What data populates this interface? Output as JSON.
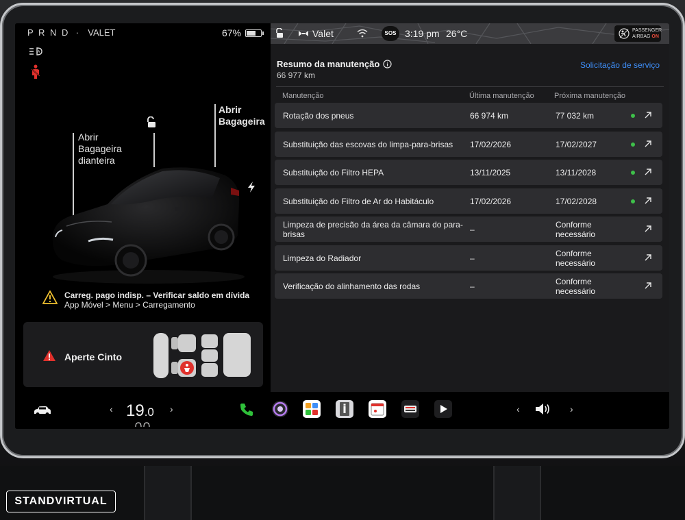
{
  "status": {
    "gear": "P R N D",
    "mode": "VALET",
    "battery_percent": "67%",
    "battery_level": 0.67
  },
  "car": {
    "frunk_label": [
      "Abrir",
      "Bagageira",
      "dianteira"
    ],
    "trunk_label": [
      "Abrir",
      "Bagageira"
    ]
  },
  "charging_warning": {
    "line1": "Carreg. pago indisp. – Verificar saldo em dívida",
    "line2": "App Móvel > Menu > Carregamento"
  },
  "seatbelt_card": {
    "label": "Aperte Cinto"
  },
  "topbar": {
    "profile": "Valet",
    "sos": "SOS",
    "time": "3:19 pm",
    "temperature": "26°C",
    "airbag_line1": "PASSENGER",
    "airbag_line2": "AIRBAG",
    "airbag_state": "ON"
  },
  "maintenance": {
    "title": "Resumo da manutenção",
    "odometer": "66 977 km",
    "service_link": "Solicitação de serviço",
    "headers": {
      "item": "Manutenção",
      "last": "Última manutenção",
      "next": "Próxima manutenção"
    },
    "rows": [
      {
        "name": "Rotação dos pneus",
        "last": "66 974 km",
        "next": "77 032 km",
        "status": "ok"
      },
      {
        "name": "Substituição das escovas do limpa-para-brisas",
        "last": "17/02/2026",
        "next": "17/02/2027",
        "status": "ok"
      },
      {
        "name": "Substituição do Filtro HEPA",
        "last": "13/11/2025",
        "next": "13/11/2028",
        "status": "ok"
      },
      {
        "name": "Substituição do Filtro de Ar do Habitáculo",
        "last": "17/02/2026",
        "next": "17/02/2028",
        "status": "ok"
      },
      {
        "name": "Limpeza de precisão da área da câmara do para-brisas",
        "last": "–",
        "next": "Conforme necessário",
        "status": "none"
      },
      {
        "name": "Limpeza do Radiador",
        "last": "–",
        "next": "Conforme necessário",
        "status": "none"
      },
      {
        "name": "Verificação do alinhamento das rodas",
        "last": "–",
        "next": "Conforme necessário",
        "status": "none"
      }
    ]
  },
  "taskbar": {
    "temp_int": "19",
    "temp_dec": ".0",
    "chevron_left": "‹",
    "chevron_right": "›"
  },
  "watermark": "STANDVIRTUAL",
  "colors": {
    "accent_link": "#3e8ef7",
    "status_ok": "#3ec04a",
    "alert_red": "#e0312c",
    "warning_yellow": "#f2c230"
  }
}
